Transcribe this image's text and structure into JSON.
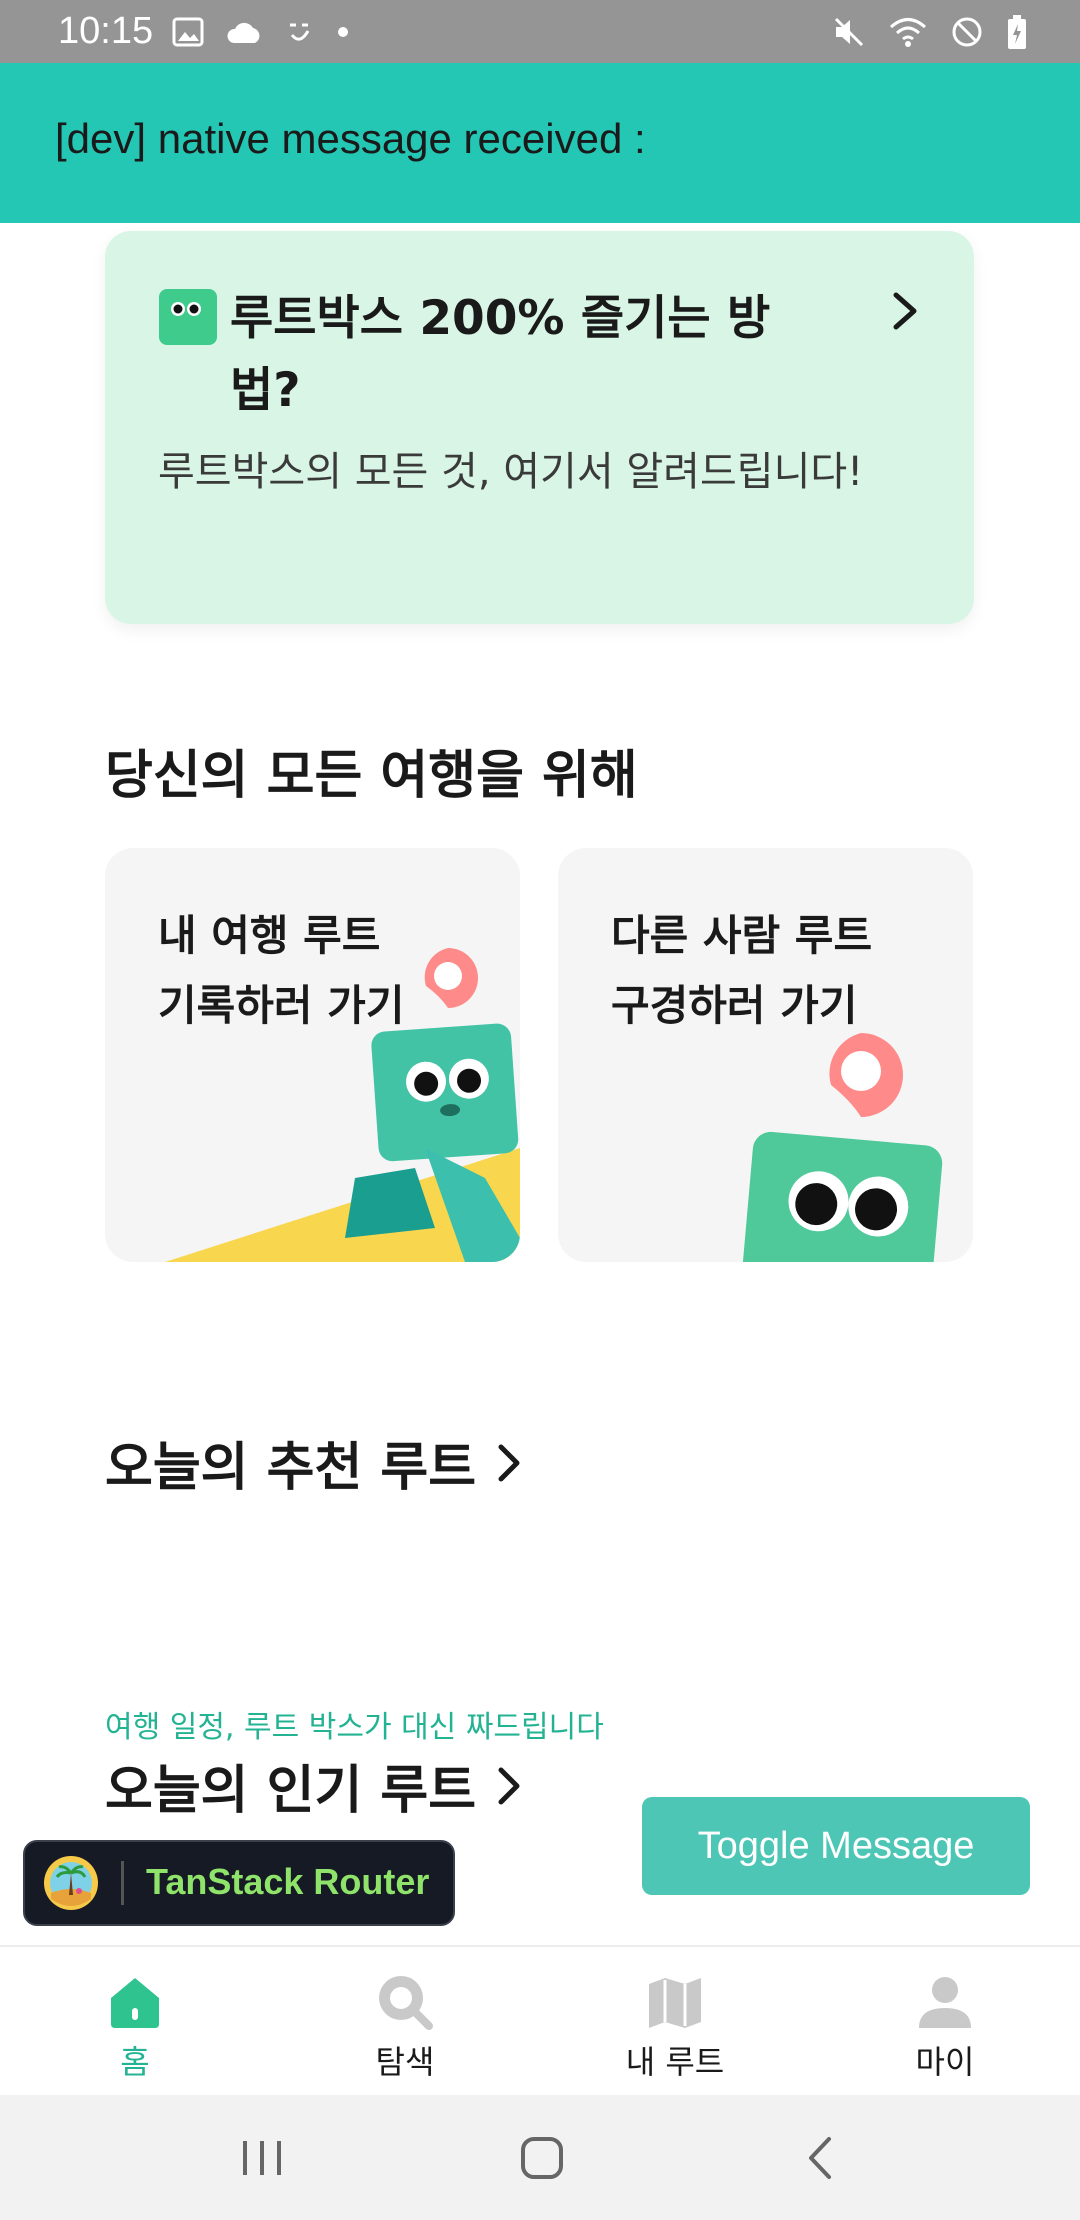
{
  "status_bar": {
    "time": "10:15",
    "icons_left": [
      "image-icon",
      "cloud-icon",
      "app-icon",
      "dot-icon"
    ],
    "icons_right": [
      "mute-icon",
      "wifi-icon",
      "dnd-icon",
      "battery-charging-icon"
    ]
  },
  "dev_banner": {
    "message": "[dev] native message received :"
  },
  "guide_card": {
    "title": "루트박스 200% 즐기는 방법?",
    "description": "루트박스의 모든 것, 여기서 알려드립니다!",
    "accent": "#d8f5e6"
  },
  "sections": {
    "all_trips": "당신의 모든 여행을 위해",
    "today_recommended": "오늘의 추천 루트",
    "popular_subtitle": "여행 일정, 루트 박스가 대신 짜드립니다",
    "today_popular": "오늘의 인기 루트"
  },
  "tiles": [
    {
      "label": "내 여행 루트\n기록하러 가기"
    },
    {
      "label": "다른 사람 루트\n구경하러 가기"
    }
  ],
  "devtools": {
    "tanstack_label": "TanStack Router"
  },
  "toggle_button": {
    "label": "Toggle Message"
  },
  "tabbar": {
    "items": [
      {
        "label": "홈",
        "icon": "home-icon",
        "active": true
      },
      {
        "label": "탐색",
        "icon": "search-icon",
        "active": false
      },
      {
        "label": "내 루트",
        "icon": "map-icon",
        "active": false
      },
      {
        "label": "마이",
        "icon": "profile-icon",
        "active": false
      }
    ]
  },
  "colors": {
    "brand": "#24c6b4",
    "accent_green": "#23b393",
    "button": "#4dc6b5"
  }
}
